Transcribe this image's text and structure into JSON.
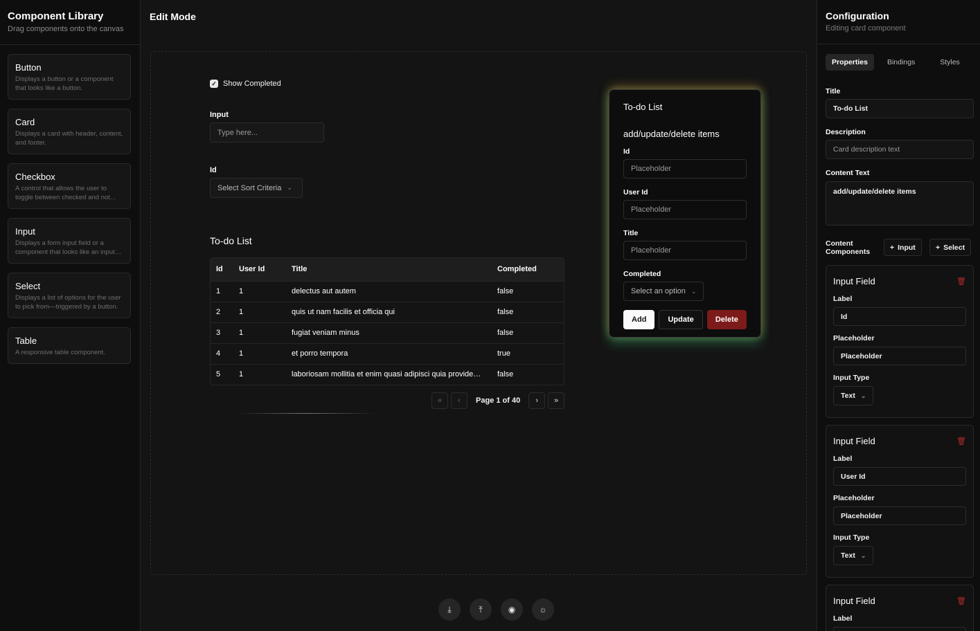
{
  "left": {
    "title": "Component Library",
    "subtitle": "Drag components onto the canvas",
    "items": [
      {
        "title": "Button",
        "desc": "Displays a button or a component that looks like a button."
      },
      {
        "title": "Card",
        "desc": "Displays a card with header, content, and footer."
      },
      {
        "title": "Checkbox",
        "desc": "A control that allows the user to toggle between checked and not…"
      },
      {
        "title": "Input",
        "desc": "Displays a form input field or a component that looks like an input…"
      },
      {
        "title": "Select",
        "desc": "Displays a list of options for the user to pick from—triggered by a button."
      },
      {
        "title": "Table",
        "desc": "A responsive table component."
      }
    ]
  },
  "center": {
    "title": "Edit Mode",
    "show_completed_label": "Show Completed",
    "input_label": "Input",
    "input_placeholder": "Type here...",
    "id_label": "Id",
    "sort_select": "Select Sort Criteria",
    "table": {
      "title": "To-do List",
      "headers": [
        "Id",
        "User Id",
        "Title",
        "Completed"
      ],
      "rows": [
        [
          "1",
          "1",
          "delectus aut autem",
          "false"
        ],
        [
          "2",
          "1",
          "quis ut nam facilis et officia qui",
          "false"
        ],
        [
          "3",
          "1",
          "fugiat veniam minus",
          "false"
        ],
        [
          "4",
          "1",
          "et porro tempora",
          "true"
        ],
        [
          "5",
          "1",
          "laboriosam mollitia et enim quasi adipisci quia provide…",
          "false"
        ]
      ],
      "page_text": "Page 1 of 40"
    },
    "card": {
      "title": "To-do List",
      "description": "add/update/delete items",
      "fields": [
        {
          "label": "Id",
          "placeholder": "Placeholder"
        },
        {
          "label": "User Id",
          "placeholder": "Placeholder"
        },
        {
          "label": "Title",
          "placeholder": "Placeholder"
        }
      ],
      "completed_label": "Completed",
      "completed_select": "Select an option",
      "add": "Add",
      "update": "Update",
      "delete": "Delete"
    }
  },
  "right": {
    "title": "Configuration",
    "subtitle": "Editing card component",
    "tabs": [
      "Properties",
      "Bindings",
      "Styles"
    ],
    "title_label": "Title",
    "title_value": "To-do List",
    "description_label": "Description",
    "description_placeholder": "Card description text",
    "content_text_label": "Content Text",
    "content_text_value": "add/update/delete items",
    "content_components_label": "Content Components",
    "add_input": "Input",
    "add_select": "Select",
    "fields": [
      {
        "title": "Input Field",
        "label_label": "Label",
        "label_value": "Id",
        "placeholder_label": "Placeholder",
        "placeholder_value": "Placeholder",
        "type_label": "Input Type",
        "type_value": "Text"
      },
      {
        "title": "Input Field",
        "label_label": "Label",
        "label_value": "User Id",
        "placeholder_label": "Placeholder",
        "placeholder_value": "Placeholder",
        "type_label": "Input Type",
        "type_value": "Text"
      },
      {
        "title": "Input Field",
        "label_label": "Label"
      }
    ]
  }
}
